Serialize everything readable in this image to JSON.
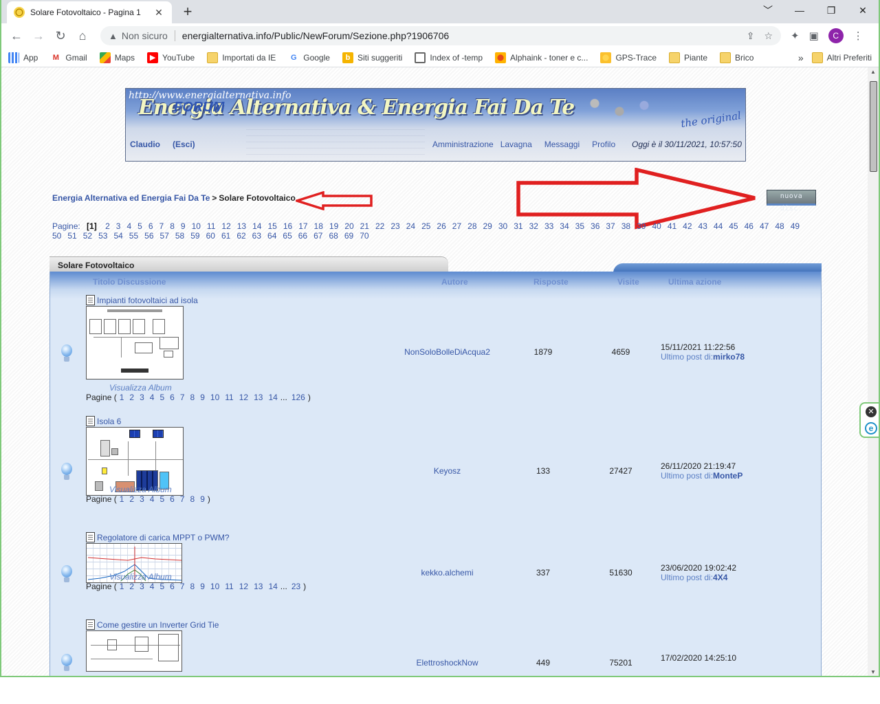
{
  "browser": {
    "tab_title": "Solare Fotovoltaico - Pagina 1",
    "tab_close": "✕",
    "new_tab": "+",
    "win_minimize": "﹀",
    "win_min": "—",
    "win_restore": "❐",
    "win_close": "✕",
    "security_label": "Non sicuro",
    "url": "energialternativa.info/Public/NewForum/Sezione.php?1906706",
    "profile_initial": "C",
    "bookmarks": [
      {
        "label": "App",
        "icon": "apps-grid-icon"
      },
      {
        "label": "Gmail",
        "icon": "gmail-icon"
      },
      {
        "label": "Maps",
        "icon": "maps-icon"
      },
      {
        "label": "YouTube",
        "icon": "youtube-icon"
      },
      {
        "label": "Importati da IE",
        "icon": "folder-icon"
      },
      {
        "label": "Google",
        "icon": "google-icon"
      },
      {
        "label": "Siti suggeriti",
        "icon": "bing-icon"
      },
      {
        "label": "Index of -temp",
        "icon": "globe-icon"
      },
      {
        "label": "Alphaink - toner e c...",
        "icon": "alphaink-icon"
      },
      {
        "label": "GPS-Trace",
        "icon": "gps-icon"
      },
      {
        "label": "Piante",
        "icon": "folder-icon"
      },
      {
        "label": "Brico",
        "icon": "folder-icon"
      }
    ],
    "bookmarks_more": "»",
    "other_bookmarks": "Altri Preferiti"
  },
  "banner": {
    "url_text": "http://www.energialternativa.info",
    "brand_text": "Energia Alternativa & Energia Fai Da Te",
    "forum_text": "FORUM",
    "original_text": "the original",
    "user": "Claudio",
    "logout": "(Esci)",
    "links": [
      "Amministrazione",
      "Lavagna",
      "Messaggi",
      "Profilo"
    ],
    "date_text": "Oggi è il 30/11/2021, 10:57:50"
  },
  "breadcrumb": {
    "root": "Energia Alternativa ed Energia Fai Da Te",
    "separator": ">",
    "current": "Solare Fotovoltaico"
  },
  "new_topic_button": "nuova disc.",
  "pagination": {
    "label": "Pagine:",
    "current": "[1]",
    "pages": [
      "2",
      "3",
      "4",
      "5",
      "6",
      "7",
      "8",
      "9",
      "10",
      "11",
      "12",
      "13",
      "14",
      "15",
      "16",
      "17",
      "18",
      "19",
      "20",
      "21",
      "22",
      "23",
      "24",
      "25",
      "26",
      "27",
      "28",
      "29",
      "30",
      "31",
      "32",
      "33",
      "34",
      "35",
      "36",
      "37",
      "38",
      "39",
      "40",
      "41",
      "42",
      "43",
      "44",
      "45",
      "46",
      "47",
      "48",
      "49",
      "50",
      "51",
      "52",
      "53",
      "54",
      "55",
      "56",
      "57",
      "58",
      "59",
      "60",
      "61",
      "62",
      "63",
      "64",
      "65",
      "66",
      "67",
      "68",
      "69",
      "70"
    ]
  },
  "forum": {
    "section_title": "Solare Fotovoltaico",
    "columns": {
      "title": "Titolo Discussione",
      "author": "Autore",
      "replies": "Risposte",
      "views": "Visite",
      "last": "Ultima azione"
    },
    "album_label": "Visualizza Album",
    "pages_label": "Pagine (",
    "pages_close": ")",
    "ellipsis": "...",
    "last_prefix": "Ultimo post di:",
    "topics": [
      {
        "title": "Impianti fotovoltaici ad isola",
        "author": "NonSoloBolleDiAcqua2",
        "replies": "1879",
        "views": "4659",
        "last_date": "15/11/2021 11:22:56",
        "last_user": "mirko78",
        "pages": [
          "1",
          "2",
          "3",
          "4",
          "5",
          "6",
          "7",
          "8",
          "9",
          "10",
          "11",
          "12",
          "13",
          "14"
        ],
        "last_page": "126"
      },
      {
        "title": "Isola 6",
        "author": "Keyosz",
        "replies": "133",
        "views": "27427",
        "last_date": "26/11/2020 21:19:47",
        "last_user": "MonteP",
        "pages": [
          "1",
          "2",
          "3",
          "4",
          "5",
          "6",
          "7",
          "8",
          "9"
        ],
        "last_page": ""
      },
      {
        "title": "Regolatore di carica MPPT o PWM?",
        "author": "kekko.alchemi",
        "replies": "337",
        "views": "51630",
        "last_date": "23/06/2020 19:02:42",
        "last_user": "4X4",
        "pages": [
          "1",
          "2",
          "3",
          "4",
          "5",
          "6",
          "7",
          "8",
          "9",
          "10",
          "11",
          "12",
          "13",
          "14"
        ],
        "last_page": "23"
      },
      {
        "title": "Come gestire un Inverter Grid Tie",
        "author": "ElettroshockNow",
        "replies": "449",
        "views": "75201",
        "last_date": "17/02/2020 14:25:10",
        "last_user": ""
      }
    ]
  },
  "colors": {
    "link": "#3656a6",
    "header_blue": "#5d8bd0",
    "annotation_red": "#e02020"
  }
}
